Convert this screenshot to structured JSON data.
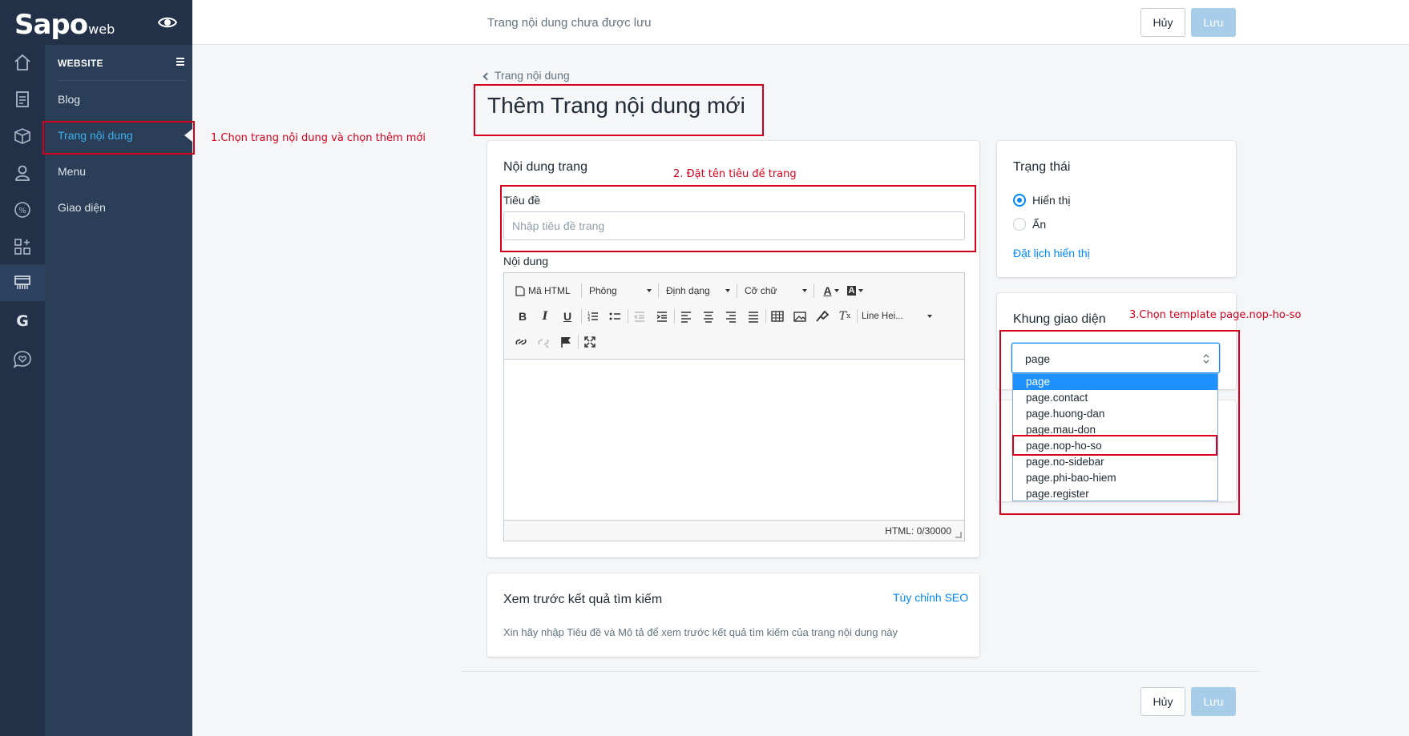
{
  "app": {
    "logo_main": "Sapo",
    "logo_sub": "web"
  },
  "topbar": {
    "unsaved_text": "Trang nội dung chưa được lưu",
    "cancel_label": "Hủy",
    "save_label": "Lưu"
  },
  "sidebar": {
    "section_title": "WEBSITE",
    "items": [
      {
        "label": "Blog"
      },
      {
        "label": "Trang nội dung"
      },
      {
        "label": "Menu"
      },
      {
        "label": "Giao diện"
      }
    ]
  },
  "header": {
    "back_label": "Trang nội dung",
    "title": "Thêm Trang nội dung mới"
  },
  "content_card": {
    "title": "Nội dung trang",
    "title_label": "Tiêu đề",
    "title_placeholder": "Nhập tiêu đề trang",
    "content_label": "Nội dung",
    "toolbar": {
      "html_label": "Mã HTML",
      "font_label": "Phông",
      "format_label": "Định dạng",
      "size_label": "Cỡ chữ",
      "lineheight_label": "Line Hei..."
    },
    "status_text": "HTML: 0/30000"
  },
  "seo_card": {
    "title": "Xem trước kết quả tìm kiếm",
    "customize_link": "Tùy chỉnh SEO",
    "hint": "Xin hãy nhập Tiêu đề và Mô tả để xem trước kết quả tìm kiếm của trang nội dung này"
  },
  "status_card": {
    "title": "Trạng thái",
    "options": [
      {
        "label": "Hiển thị",
        "checked": true
      },
      {
        "label": "Ẩn",
        "checked": false
      }
    ],
    "schedule_link": "Đặt lịch hiển thị"
  },
  "template_card": {
    "title": "Khung giao diện",
    "selected": "page",
    "options": [
      "page",
      "page.contact",
      "page.huong-dan",
      "page.mau-don",
      "page.nop-ho-so",
      "page.no-sidebar",
      "page.phi-bao-hiem",
      "page.register"
    ]
  },
  "annotations": {
    "step1": "1.Chọn trang nội dung và chọn thêm mới",
    "step2": "2. Đặt tên tiêu đề trang",
    "step3": "3.Chọn template page.nop-ho-so"
  },
  "colors": {
    "sidebar": "#2b3e57",
    "rail": "#223147",
    "accent": "#0088ff",
    "annotation": "#d6001c"
  }
}
